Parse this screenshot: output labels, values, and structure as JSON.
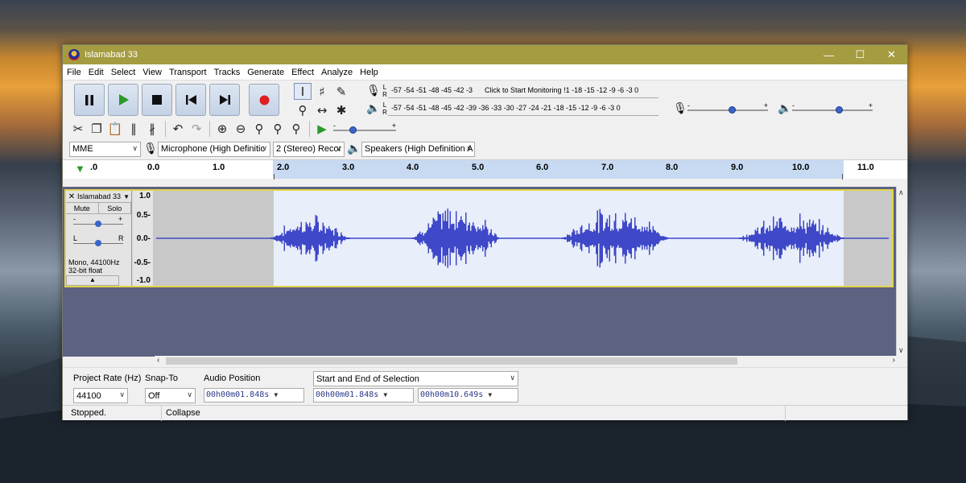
{
  "window": {
    "title": "Islamabad 33"
  },
  "menu": [
    "File",
    "Edit",
    "Select",
    "View",
    "Transport",
    "Tracks",
    "Generate",
    "Effect",
    "Analyze",
    "Help"
  ],
  "meters": {
    "record_scale": "-57 -54 -51 -48 -45 -42 -3",
    "record_scale_right": "!1 -18 -15 -12 -9 -6 -3 0",
    "record_hint": "Click to Start Monitoring",
    "playback_scale": "-57 -54 -51 -48 -45 -42 -39 -36 -33 -30 -27 -24 -21 -18 -15 -12 -9 -6 -3 0",
    "lr": [
      "L",
      "R"
    ]
  },
  "devices": {
    "host": "MME",
    "mic": "Microphone (High Definitic",
    "channels": "2 (Stereo) Recor",
    "speakers": "Speakers (High Definition A"
  },
  "ruler": {
    "labels": [
      ".0",
      "0.0",
      "1.0",
      "2.0",
      "3.0",
      "4.0",
      "5.0",
      "6.0",
      "7.0",
      "8.0",
      "9.0",
      "10.0",
      "11.0"
    ]
  },
  "track": {
    "name": "Islamabad 33",
    "mute": "Mute",
    "solo": "Solo",
    "gain_marks": [
      "-",
      "+"
    ],
    "pan_marks": [
      "L",
      "R"
    ],
    "info_line1": "Mono, 44100Hz",
    "info_line2": "32-bit float",
    "scale": [
      "1.0",
      "0.5-",
      "0.0-",
      "-0.5-",
      "-1.0"
    ]
  },
  "selection_toolbar": {
    "project_rate_label": "Project Rate (Hz)",
    "project_rate": "44100",
    "snap_to_label": "Snap-To",
    "snap_to": "Off",
    "audio_position_label": "Audio Position",
    "audio_position": "00h00m01.848s",
    "selection_mode": "Start and End of Selection",
    "selection_start": "00h00m01.848s",
    "selection_end": "00h00m10.649s"
  },
  "status": {
    "state": "Stopped.",
    "hint": "Collapse"
  },
  "colors": {
    "titlebar": "#a59c42",
    "waveform": "#3f48c8",
    "selection": "#e8eefa",
    "track_border": "#e4d44c"
  }
}
